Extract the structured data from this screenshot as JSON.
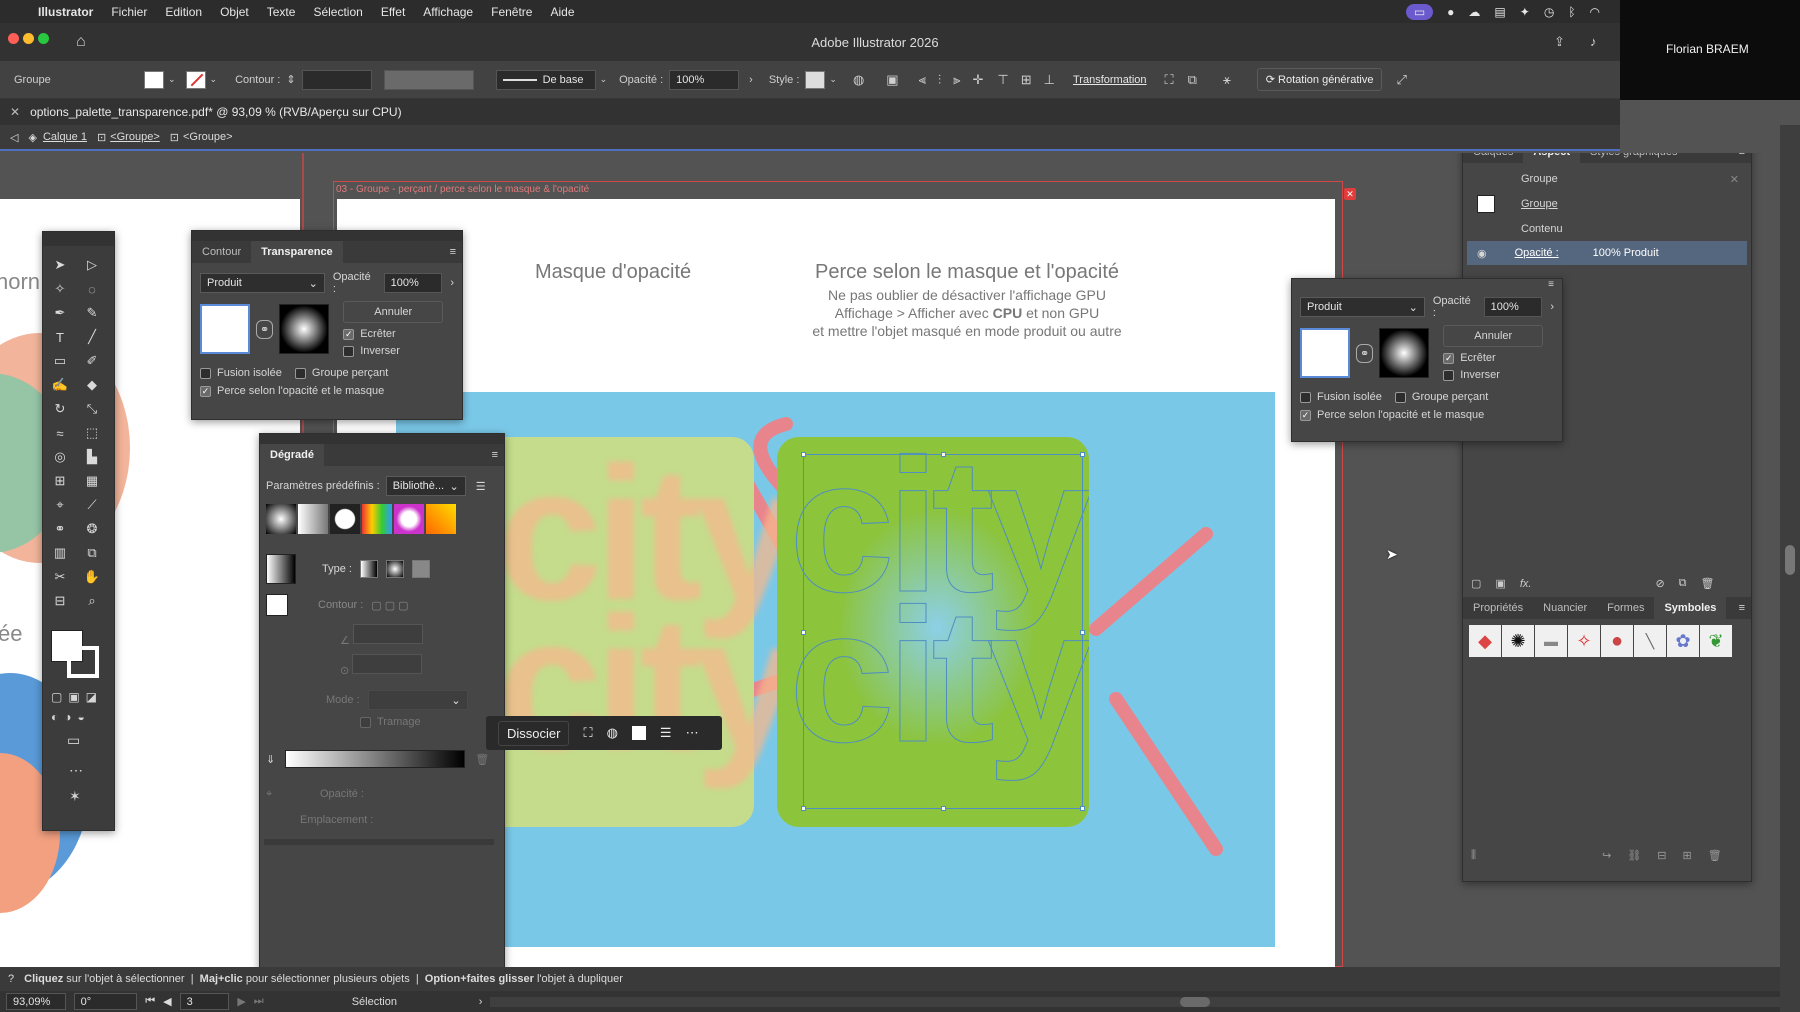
{
  "menubar": {
    "app": "Illustrator",
    "items": [
      "Fichier",
      "Edition",
      "Objet",
      "Texte",
      "Sélection",
      "Effet",
      "Affichage",
      "Fenêtre",
      "Aide"
    ]
  },
  "window": {
    "title": "Adobe Illustrator 2026",
    "user": "Florian BRAEM"
  },
  "control": {
    "selection_type": "Groupe",
    "stroke_label": "Contour :",
    "brush_label": "De base",
    "opacity_label": "Opacité :",
    "opacity_value": "100%",
    "style_label": "Style :",
    "transform_label": "Transformation",
    "generative_label": "Rotation générative"
  },
  "document": {
    "tab_title": "options_palette_transparence.pdf* @ 93,09 % (RVB/Aperçu sur CPU)",
    "breadcrumb": [
      "Calque 1",
      "<Groupe>",
      "<Groupe>"
    ]
  },
  "artboard": {
    "label": "03 - Groupe - perçant / perce selon le masque & l'opacité",
    "left_heading": "Masque d'opacité",
    "right_heading": "Perce selon le masque et l'opacité",
    "note_line1": "Ne pas oublier de désactiver l'affichage GPU",
    "note_line2_a": "Affichage > Afficher avec ",
    "note_line2_b": "CPU",
    "note_line2_c": " et non GPU",
    "note_line3": "et mettre l'objet masqué en mode produit ou autre",
    "left_word": "city",
    "side_text_top": "norn",
    "side_text_mid": "ée",
    "colors": {
      "sky": "#7ac8e8",
      "green": "#8cc43c",
      "pale_green": "#c4dc8c",
      "pink": "#e8848c"
    }
  },
  "transparency_panel": {
    "tabs": [
      "Contour",
      "Transparence"
    ],
    "active_tab": "Transparence",
    "blend_mode": "Produit",
    "opacity_label": "Opacité :",
    "opacity_value": "100%",
    "annuler": "Annuler",
    "ecreter": "Ecrêter",
    "inverser": "Inverser",
    "fusion_isolee": "Fusion isolée",
    "groupe_percant": "Groupe perçant",
    "perce": "Perce selon l'opacité et le masque"
  },
  "gradient_panel": {
    "title": "Dégradé",
    "presets_label": "Paramètres prédéfinis :",
    "presets_value": "Bibliothè...",
    "type_label": "Type :",
    "contour_label": "Contour :",
    "mode_label": "Mode :",
    "tramage": "Tramage",
    "opacite": "Opacité :",
    "emplacement": "Emplacement :"
  },
  "context_bar": {
    "dissocier": "Dissocier"
  },
  "appearance_panel": {
    "tabs": [
      "Calques",
      "Aspect",
      "Styles graphiques"
    ],
    "active_tab": "Aspect",
    "rows": {
      "group_head": "Groupe",
      "group": "Groupe",
      "contenu": "Contenu",
      "opacity_label": "Opacité :",
      "opacity_value": "100% Produit"
    }
  },
  "floating_transparency": {
    "blend_mode": "Produit",
    "opacity_label": "Opacité :",
    "opacity_value": "100%",
    "annuler": "Annuler",
    "ecreter": "Ecrêter",
    "inverser": "Inverser",
    "fusion_isolee": "Fusion isolée",
    "groupe_percant": "Groupe perçant",
    "perce": "Perce selon l'opacité et le masque"
  },
  "symbols_panel": {
    "tabs": [
      "Propriétés",
      "Nuancier",
      "Formes",
      "Symboles"
    ],
    "active_tab": "Symboles"
  },
  "statusbar": {
    "hint_a": "Cliquez",
    "hint_b": " sur l'objet à sélectionner  |  ",
    "hint_c": "Maj+clic",
    "hint_d": " pour sélectionner plusieurs objets  |  ",
    "hint_e": "Option+faites glisser",
    "hint_f": " l'objet à dupliquer",
    "zoom": "93,09%",
    "angle": "0°",
    "artboard_num": "3",
    "mode": "Sélection"
  }
}
